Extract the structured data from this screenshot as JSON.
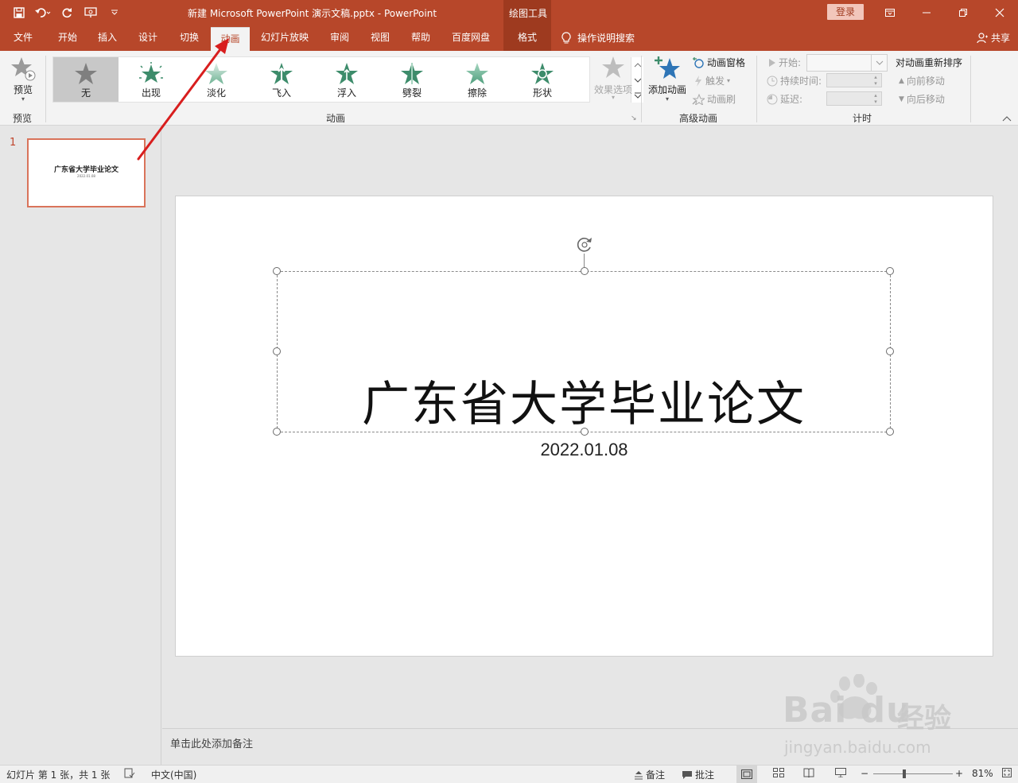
{
  "window": {
    "title": "新建 Microsoft PowerPoint 演示文稿.pptx  -  PowerPoint",
    "context_tab_group": "绘图工具",
    "login_label": "登录"
  },
  "tabs": [
    "文件",
    "开始",
    "插入",
    "设计",
    "切换",
    "动画",
    "幻灯片放映",
    "审阅",
    "视图",
    "帮助",
    "百度网盘",
    "格式"
  ],
  "active_tab": "动画",
  "tell_me": "操作说明搜索",
  "share_label": "共享",
  "ribbon": {
    "preview": {
      "button": "预览",
      "group": "预览"
    },
    "animation_gallery": {
      "items": [
        {
          "label": "无",
          "selected": true
        },
        {
          "label": "出现"
        },
        {
          "label": "淡化"
        },
        {
          "label": "飞入"
        },
        {
          "label": "浮入"
        },
        {
          "label": "劈裂"
        },
        {
          "label": "擦除"
        },
        {
          "label": "形状"
        }
      ],
      "effect_options": "效果选项",
      "group": "动画"
    },
    "advanced": {
      "add_animation": "添加动画",
      "animation_pane": "动画窗格",
      "trigger": "触发",
      "animation_painter": "动画刷",
      "group": "高级动画"
    },
    "timing": {
      "start": "开始:",
      "duration": "持续时间:",
      "delay": "延迟:",
      "reorder": "对动画重新排序",
      "move_earlier": "向前移动",
      "move_later": "向后移动",
      "group": "计时"
    }
  },
  "slide_panel": {
    "slide_number": "1",
    "thumb_title": "广东省大学毕业论文",
    "thumb_date": "2022.01.08"
  },
  "slide": {
    "title": "广东省大学毕业论文",
    "date": "2022.01.08"
  },
  "notes_placeholder": "单击此处添加备注",
  "status": {
    "slide_info": "幻灯片 第 1 张，共 1 张",
    "language": "中文(中国)",
    "notes": "备注",
    "comments": "批注",
    "zoom": "81%"
  },
  "watermark": {
    "logo": "Bai du",
    "cn": "经验",
    "url": "jingyan.baidu.com"
  },
  "colors": {
    "accent": "#b7472a",
    "arrow": "#d81e1e"
  }
}
